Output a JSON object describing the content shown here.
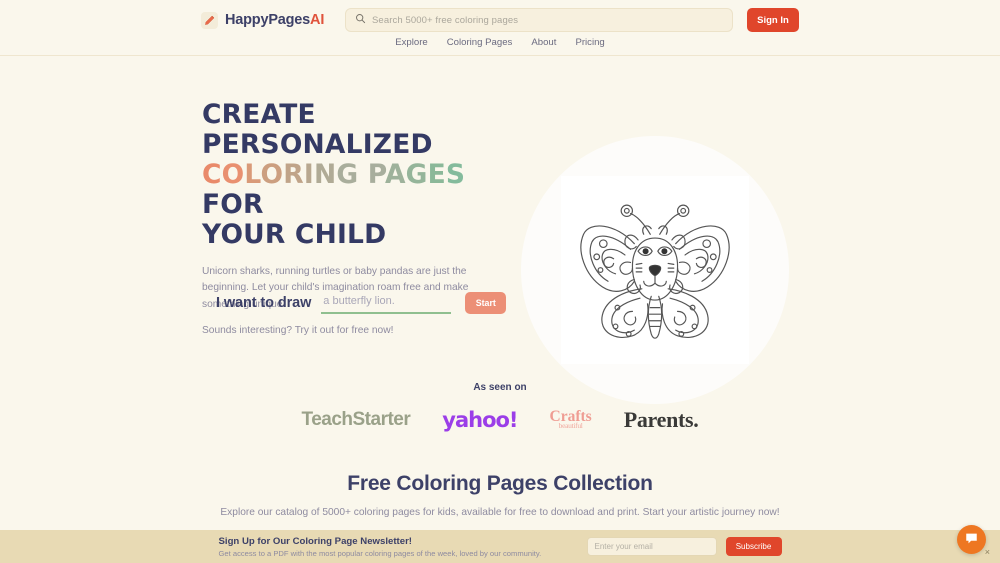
{
  "header": {
    "logo": {
      "icon": "pencil-icon",
      "text_main": "HappyPages",
      "text_accent": "AI"
    },
    "search": {
      "icon": "search-icon",
      "placeholder": "Search 5000+ free coloring pages",
      "value": ""
    },
    "signin_label": "Sign In",
    "nav": [
      {
        "label": "Explore"
      },
      {
        "label": "Coloring Pages"
      },
      {
        "label": "About"
      },
      {
        "label": "Pricing"
      }
    ]
  },
  "hero": {
    "headline_line1": "Create Personalized",
    "headline_word_coloring": "Coloring",
    "headline_word_pages": "Pages",
    "headline_word_for": "for",
    "headline_line3": "Your Child",
    "paragraph": "Unicorn sharks, running turtles or baby pandas are just the beginning. Let your child's imagination roam free and make something unique.",
    "paragraph2": "Sounds interesting? Try it out for free now!",
    "draw_label": "I want to draw",
    "draw_placeholder": "a butterfly lion.",
    "draw_value": "",
    "start_label": "Start",
    "illustration": "butterfly-lion-coloring-page"
  },
  "as_seen_on": {
    "title": "As seen on",
    "brands": [
      {
        "name": "TeachStarter"
      },
      {
        "name": "yahoo!"
      },
      {
        "name": "Crafts",
        "sub": "beautiful"
      },
      {
        "name": "Parents."
      }
    ]
  },
  "collection": {
    "title": "Free Coloring Pages Collection",
    "description": "Explore our catalog of 5000+ coloring pages for kids, available for free to download and print. Start your artistic journey now!"
  },
  "newsletter": {
    "title": "Sign Up for Our Coloring Page Newsletter!",
    "subtitle": "Get access to a PDF with the most popular coloring pages of the week, loved by our community.",
    "email_placeholder": "Enter your email",
    "email_value": "",
    "subscribe_label": "Subscribe"
  },
  "chat": {
    "icon": "chat-bubble-icon",
    "close_label": "×"
  },
  "colors": {
    "page_bg": "#faf7ec",
    "navy": "#343a64",
    "accent_red": "#e0462b",
    "salmon": "#ec8f76",
    "green": "#8fbf8f",
    "newsletter_bg": "#e8dab4",
    "chat_orange": "#ee7722"
  },
  "headline_letter_colors": {
    "coloring": [
      "#e98a6a",
      "#e99070",
      "#d99a78",
      "#cc9f80",
      "#c0a489",
      "#b8a890",
      "#b0ab96",
      "#a9ae9c"
    ],
    "pages": [
      "#a8ae9d",
      "#9eb29b",
      "#95b59a",
      "#8bb899",
      "#84bb9c"
    ]
  }
}
